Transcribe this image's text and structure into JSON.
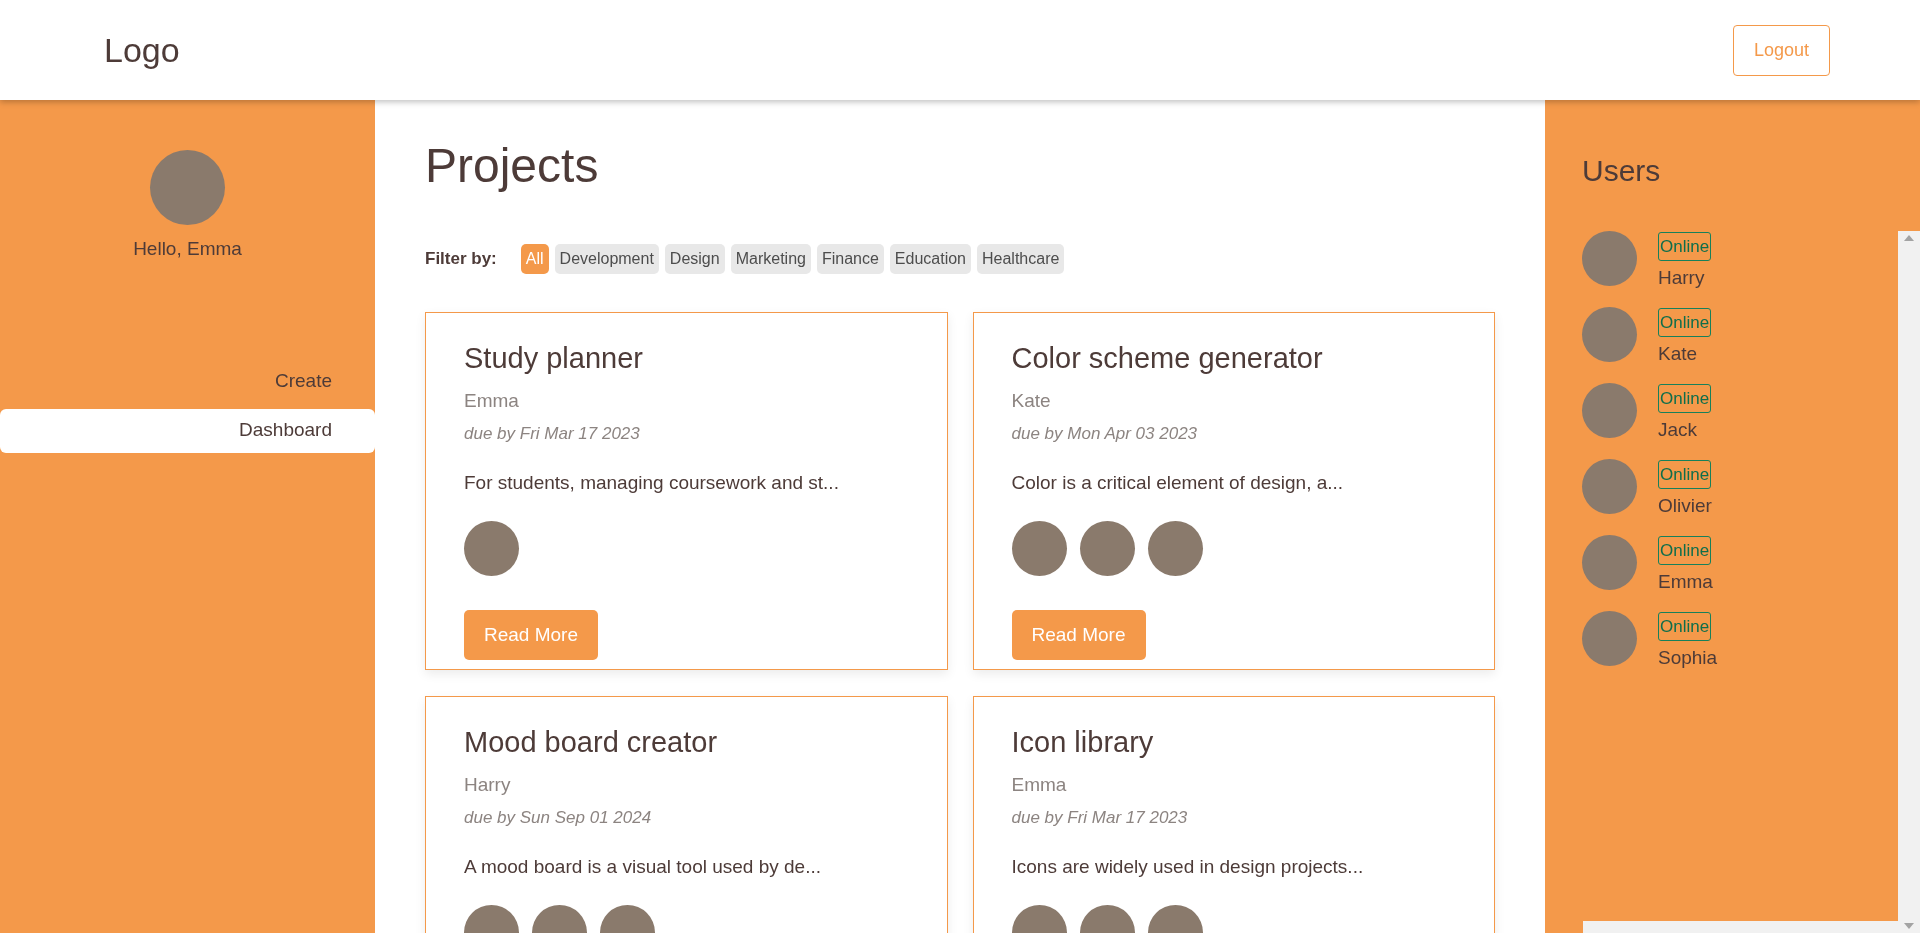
{
  "header": {
    "logo": "Logo",
    "logout": "Logout"
  },
  "sidebar": {
    "greeting": "Hello, Emma",
    "nav": [
      {
        "label": "Create",
        "selected": false
      },
      {
        "label": "Dashboard",
        "selected": true
      }
    ]
  },
  "main": {
    "title": "Projects",
    "filter_label": "Filter by:",
    "filters": [
      {
        "label": "All",
        "selected": true
      },
      {
        "label": "Development",
        "selected": false
      },
      {
        "label": "Design",
        "selected": false
      },
      {
        "label": "Marketing",
        "selected": false
      },
      {
        "label": "Finance",
        "selected": false
      },
      {
        "label": "Education",
        "selected": false
      },
      {
        "label": "Healthcare",
        "selected": false
      }
    ],
    "projects": [
      {
        "title": "Study planner",
        "owner": "Emma",
        "due": "due by Fri Mar 17 2023",
        "description": "For students, managing coursework and st...",
        "members": [
          {
            "kind": "photo"
          }
        ],
        "button": "Read More"
      },
      {
        "title": "Color scheme generator",
        "owner": "Kate",
        "due": "due by Mon Apr 03 2023",
        "description": "Color is a critical element of design, a...",
        "members": [
          {
            "kind": "photo"
          },
          {
            "kind": "photo"
          },
          {
            "kind": "photo"
          }
        ],
        "button": "Read More"
      },
      {
        "title": "Mood board creator",
        "owner": "Harry",
        "due": "due by Sun Sep 01 2024",
        "description": "A mood board is a visual tool used by de...",
        "members": [
          {
            "kind": "photo"
          },
          {
            "kind": "photo"
          },
          {
            "kind": "photo"
          }
        ]
      },
      {
        "title": "Icon library",
        "owner": "Emma",
        "due": "due by Fri Mar 17 2023",
        "description": "Icons are widely used in design projects...",
        "members": [
          {
            "kind": "photo"
          },
          {
            "kind": "photo"
          },
          {
            "kind": "photo"
          }
        ]
      }
    ]
  },
  "users": {
    "title": "Users",
    "list": [
      {
        "name": "Harry",
        "status": "Online"
      },
      {
        "name": "Kate",
        "status": "Online"
      },
      {
        "name": "Jack",
        "status": "Online"
      },
      {
        "name": "Olivier",
        "status": "Online"
      },
      {
        "name": "Emma",
        "status": "Online"
      },
      {
        "name": "Sophia",
        "status": "Online"
      }
    ]
  }
}
